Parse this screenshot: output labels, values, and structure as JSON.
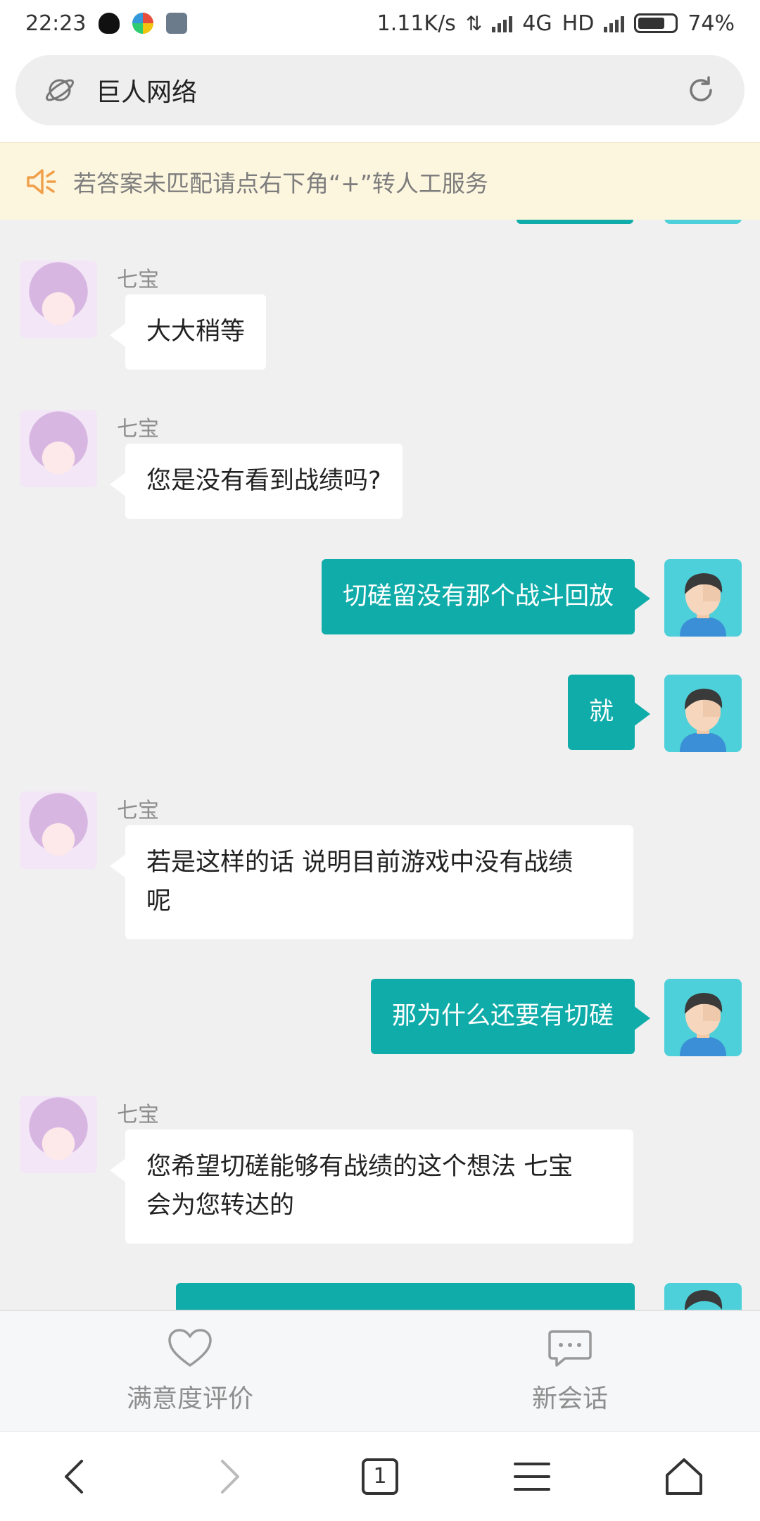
{
  "status_bar": {
    "time": "22:23",
    "network_speed": "1.11K/s",
    "network_type": "4G",
    "hd_label": "HD",
    "battery": "74%",
    "battery_level": 0.74
  },
  "address_bar": {
    "title": "巨人网络"
  },
  "notice": {
    "text": "若答案未匹配请点右下角“+”转人工服务"
  },
  "chat": {
    "bot_name": "七宝",
    "messages": [
      {
        "from": "bot",
        "text": "大大稍等"
      },
      {
        "from": "bot",
        "text": "您是没有看到战绩吗?"
      },
      {
        "from": "user",
        "text": "切磋留没有那个战斗回放"
      },
      {
        "from": "user",
        "text": "就"
      },
      {
        "from": "bot",
        "text": "若是这样的话 说明目前游戏中没有战绩\n呢"
      },
      {
        "from": "user",
        "text": "那为什么还要有切磋"
      },
      {
        "from": "bot",
        "text": "您希望切磋能够有战绩的这个想法 七宝\n会为您转达的"
      }
    ]
  },
  "actions": {
    "rate_label": "满意度评价",
    "new_chat_label": "新会话"
  },
  "nav": {
    "tab_count": "1"
  },
  "colors": {
    "accent": "#0faca9",
    "notice_bg": "#fdf6df",
    "chat_bg": "#f0f0f0"
  }
}
